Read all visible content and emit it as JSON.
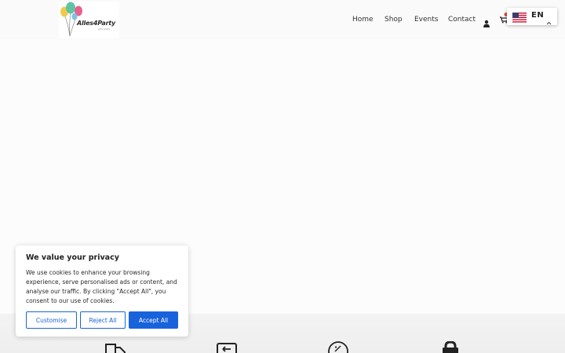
{
  "brand": {
    "name": "Alles4Party",
    "tagline": "let's party"
  },
  "nav": {
    "home": "Home",
    "shop": "Shop",
    "events": "Events",
    "contact": "Contact"
  },
  "icons": {
    "account": "user-icon",
    "cart": "cart-icon",
    "flag": "us-flag-icon",
    "chevron": "chevron-up-icon"
  },
  "language": {
    "code": "EN"
  },
  "cookie_banner": {
    "title": "We value your privacy",
    "body": "We use cookies to enhance your browsing experience, serve personalised ads or content, and analyse our traffic. By clicking \"Accept All\", you consent to our use of cookies.",
    "customise_label": "Customise",
    "reject_label": "Reject All",
    "accept_label": "Accept All"
  },
  "colors": {
    "accent": "#1863dc",
    "cart_badge": "#e8403a",
    "balloon_green": "#5fc4a2",
    "balloon_pink": "#e8608b",
    "balloon_yellow": "#f2c94c",
    "balloon_blue": "#7fbfe6"
  }
}
